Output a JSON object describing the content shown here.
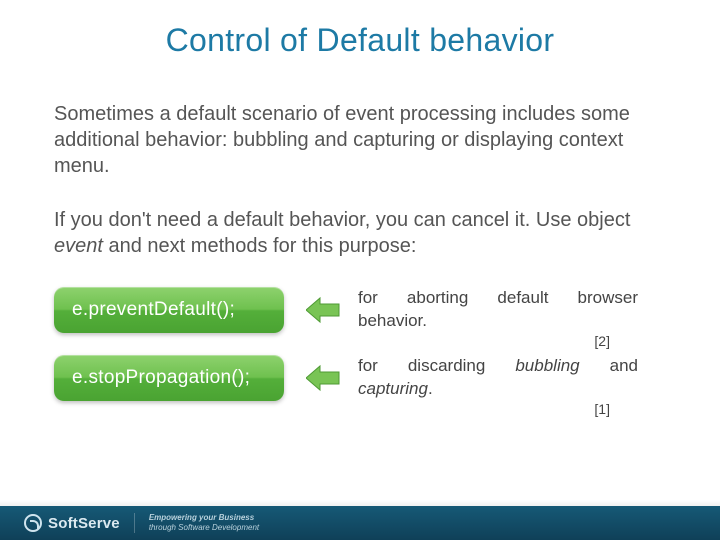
{
  "title": "Control of Default behavior",
  "para1_a": "Sometimes a default scenario of event processing includes some additional behavior: bubbling and capturing or displaying context menu.",
  "para2_a": "If you don't need a default behavior, you can cancel it. Use object ",
  "para2_em": "event",
  "para2_b": " and next methods for this purpose:",
  "methods": [
    {
      "code": "e.preventDefault();",
      "desc_a": "for aborting default browser behavior.",
      "ref": "[2]"
    },
    {
      "code": "e.stopPropagation();",
      "desc_a": "for discarding ",
      "desc_em1": "bubbling",
      "desc_mid": " and ",
      "desc_em2": "capturing",
      "desc_end": ".",
      "ref": "[1]"
    }
  ],
  "footer": {
    "brand": "SoftServe",
    "tag_top": "Empowering your Business",
    "tag_bot": "through Software Development"
  }
}
